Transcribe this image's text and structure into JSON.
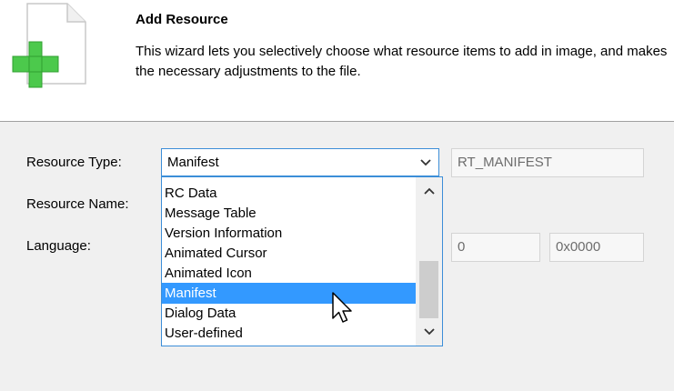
{
  "header": {
    "title": "Add Resource",
    "description": "This wizard lets you selectively choose what resource items to add in image, and makes the necessary adjustments to the file.",
    "icon": "add-resource-document-icon"
  },
  "form": {
    "resource_type_label": "Resource Type:",
    "resource_name_label": "Resource Name:",
    "language_label": "Language:",
    "resource_type_value": "Manifest",
    "resource_type_id": "RT_MANIFEST",
    "language_value": "0",
    "language_hex": "0x0000"
  },
  "dropdown": {
    "items": [
      "RC Data",
      "Message Table",
      "Version Information",
      "Animated Cursor",
      "Animated Icon",
      "Manifest",
      "Dialog Data",
      "User-defined"
    ],
    "selected": "Manifest"
  },
  "colors": {
    "accent": "#3c8ed8",
    "selection": "#3399ff",
    "plus_green": "#4cc94c"
  }
}
